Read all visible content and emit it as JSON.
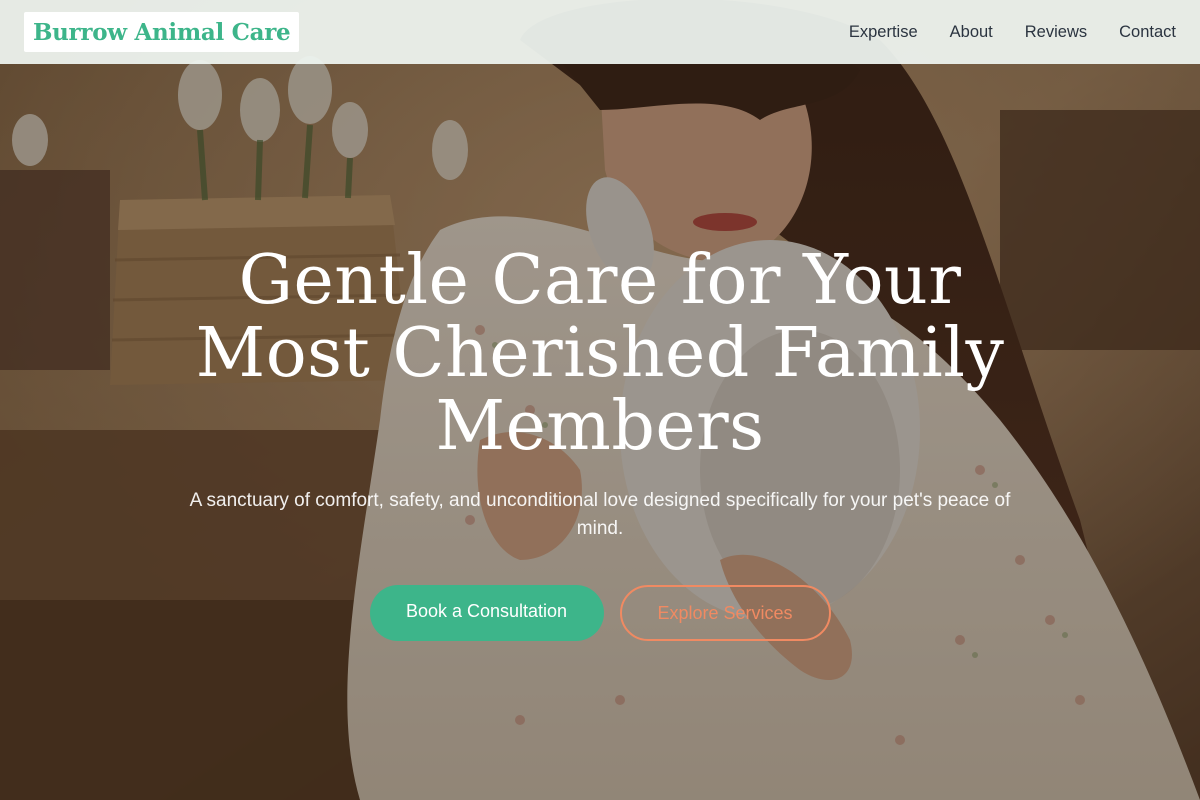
{
  "header": {
    "logo_text": "Burrow Animal Care",
    "nav": [
      {
        "label": "Expertise"
      },
      {
        "label": "About"
      },
      {
        "label": "Reviews"
      },
      {
        "label": "Contact"
      }
    ]
  },
  "hero": {
    "title": "Gentle Care for Your Most Cherished Family Members",
    "subtitle": "A sanctuary of comfort, safety, and unconditional love designed specifically for your pet's peace of mind.",
    "primary_cta": "Book a Consultation",
    "secondary_cta": "Explore Services",
    "background_image": "woman-holding-white-rabbit-photo"
  },
  "colors": {
    "accent": "#3db58a",
    "secondary_accent": "#f08a62",
    "nav_text": "#2b3440"
  }
}
